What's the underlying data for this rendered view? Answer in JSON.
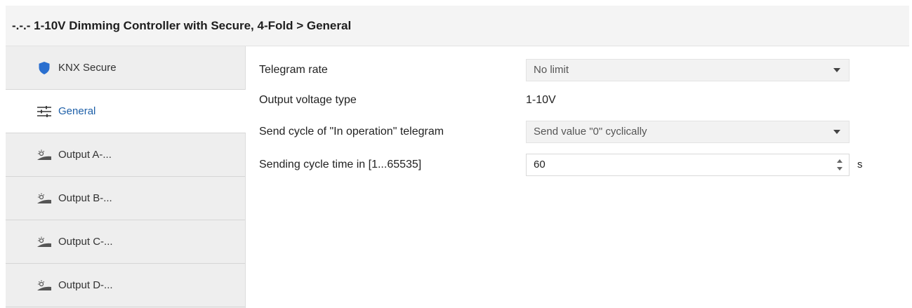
{
  "header": {
    "title": "-.-.- 1-10V Dimming Controller with Secure, 4-Fold > General"
  },
  "sidebar": {
    "items": [
      {
        "label": "KNX Secure",
        "icon": "shield-icon"
      },
      {
        "label": "General",
        "icon": "sliders-icon",
        "active": true
      },
      {
        "label": "Output A-...",
        "icon": "output-icon"
      },
      {
        "label": "Output B-...",
        "icon": "output-icon"
      },
      {
        "label": "Output C-...",
        "icon": "output-icon"
      },
      {
        "label": "Output D-...",
        "icon": "output-icon"
      }
    ]
  },
  "parameters": {
    "telegram_rate": {
      "label": "Telegram rate",
      "value": "No limit"
    },
    "output_voltage_type": {
      "label": "Output voltage type",
      "value": "1-10V"
    },
    "send_cycle": {
      "label": "Send cycle of  \"In operation\" telegram",
      "value": "Send value \"0\" cyclically"
    },
    "sending_cycle_time": {
      "label": "Sending cycle time in [1...65535]",
      "value": "60",
      "unit": "s"
    }
  },
  "colors": {
    "accent": "#1d5fa8",
    "shield": "#2a6fcf",
    "sidebar_bg": "#eeeeee",
    "header_bg": "#f4f4f4"
  }
}
